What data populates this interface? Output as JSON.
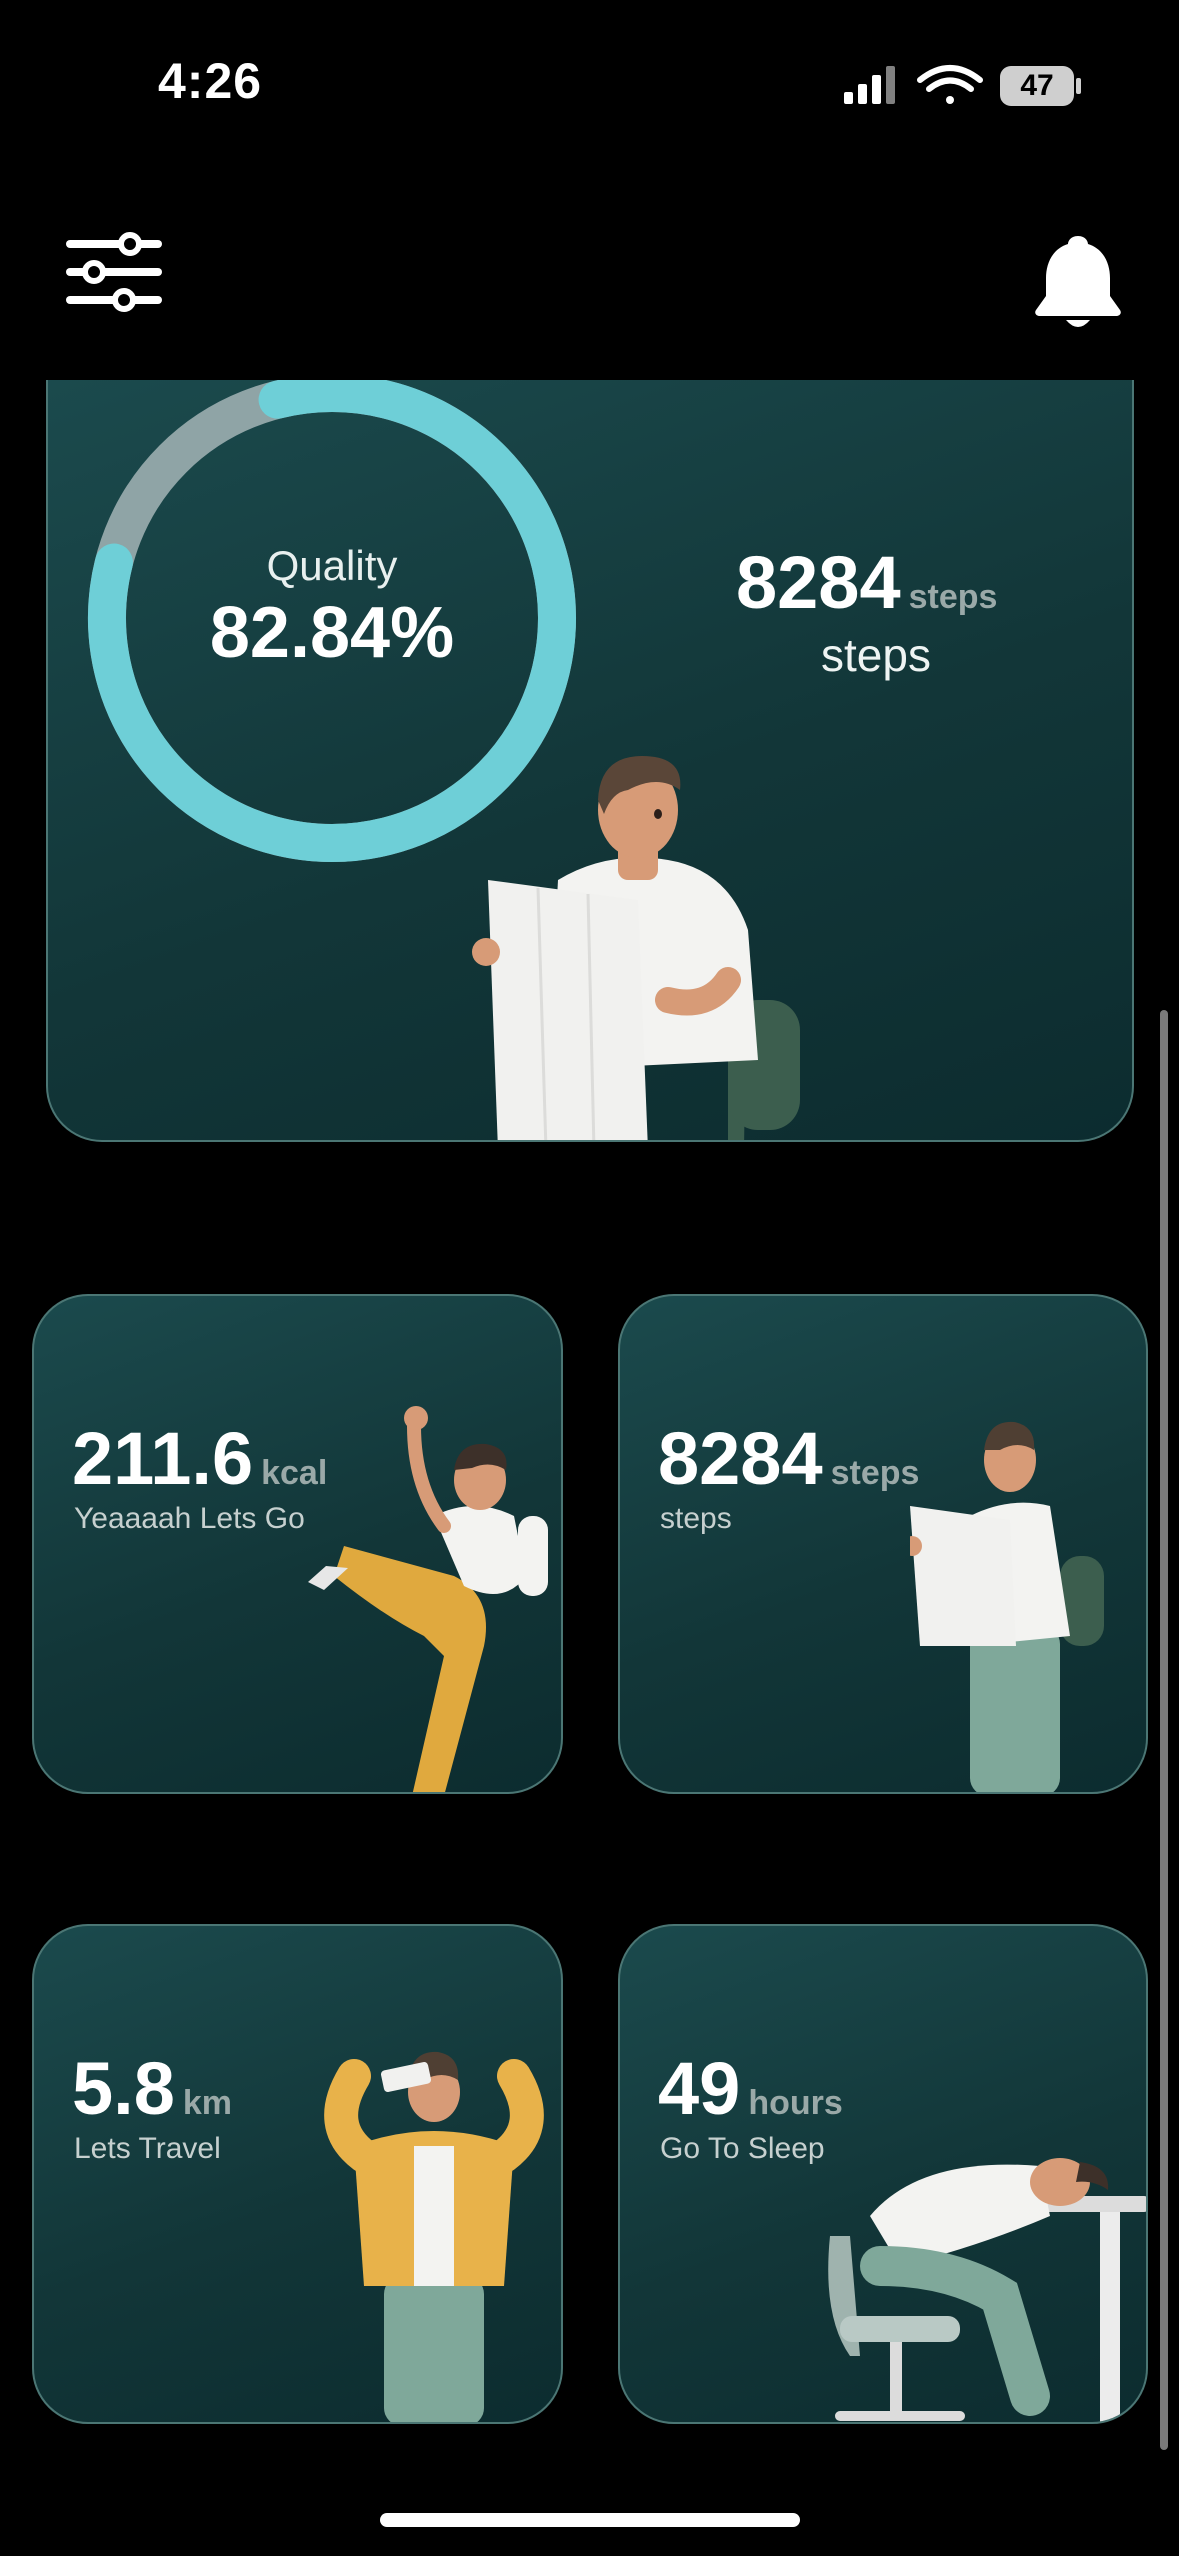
{
  "status_bar": {
    "time": "4:26",
    "battery": "47"
  },
  "header": {
    "filter_icon": "sliders-icon",
    "notification_icon": "bell-icon"
  },
  "quality_card": {
    "label": "Quality",
    "value": "82.84%",
    "progress": 0.8284,
    "steps_value": "8284",
    "steps_unit": "steps",
    "steps_caption": "steps",
    "ring_color": "#6ecfd7",
    "ring_track_color": "#8fa4a6"
  },
  "cards": [
    {
      "value": "211.6",
      "unit": "kcal",
      "caption": "Yeaaaah Lets Go"
    },
    {
      "value": "8284",
      "unit": "steps",
      "caption": "steps"
    },
    {
      "value": "5.8",
      "unit": "km",
      "caption": "Lets Travel"
    },
    {
      "value": "49",
      "unit": "hours",
      "caption": "Go To Sleep"
    }
  ],
  "colors": {
    "card_bg": "#123638",
    "card_border": "#4b7674",
    "accent": "#6ecfd7"
  }
}
